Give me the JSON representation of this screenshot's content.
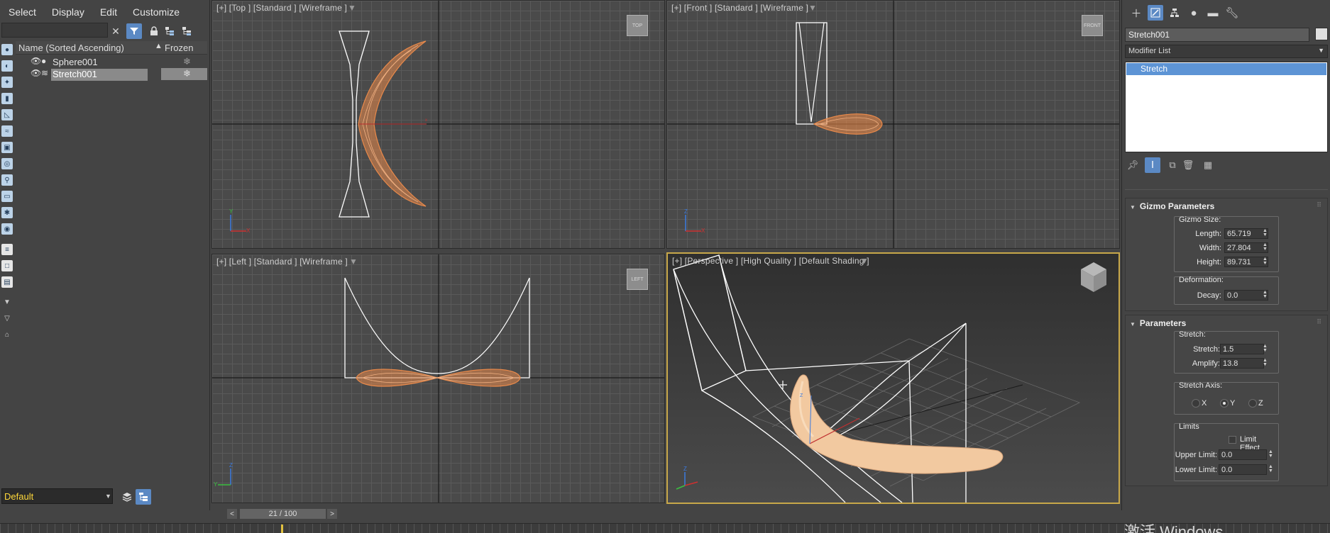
{
  "menu": {
    "items": [
      "Select",
      "Display",
      "Edit",
      "Customize"
    ]
  },
  "explorer": {
    "search_placeholder": "",
    "columns": {
      "name": "Name (Sorted Ascending)",
      "sort_glyph": "▲",
      "frozen": "Frozen"
    },
    "rows": [
      {
        "name": "Sphere001",
        "frozen_glyph": "❄"
      },
      {
        "name": "Stretch001",
        "frozen_glyph": "❄"
      }
    ],
    "selected_row": "Stretch001"
  },
  "layer": {
    "current": "Default"
  },
  "viewports": {
    "top": {
      "label": "[+] [Top ] [Standard ] [Wireframe ]",
      "cube": "TOP"
    },
    "front": {
      "label": "[+] [Front ] [Standard ] [Wireframe ]",
      "cube": "FRONT"
    },
    "left": {
      "label": "[+] [Left ] [Standard ] [Wireframe ]",
      "cube": "LEFT"
    },
    "perspective": {
      "label": "[+] [Perspective ] [High Quality ] [Default Shading ]"
    }
  },
  "timeline": {
    "frame_display": "21 / 100",
    "prev": "<",
    "next": ">"
  },
  "watermark": "激活 Windows",
  "command_panel": {
    "object_name": "Stretch001",
    "modifier_list_label": "Modifier List",
    "stack": [
      "Stretch"
    ],
    "gizmo_parameters": {
      "title": "Gizmo Parameters",
      "gizmo_size_label": "Gizmo Size:",
      "length_label": "Length:",
      "length": "65.719",
      "width_label": "Width:",
      "width": "27.804",
      "height_label": "Height:",
      "height": "89.731",
      "deformation_label": "Deformation:",
      "decay_label": "Decay:",
      "decay": "0.0"
    },
    "parameters": {
      "title": "Parameters",
      "stretch_group_label": "Stretch:",
      "stretch_label": "Stretch:",
      "stretch": "1.5",
      "amplify_label": "Amplify:",
      "amplify": "13.8",
      "stretch_axis_label": "Stretch Axis:",
      "axis_x": "X",
      "axis_y": "Y",
      "axis_z": "Z",
      "selected_axis": "Y",
      "limits_label": "Limits",
      "limit_effect_label": "Limit Effect",
      "limit_effect_checked": false,
      "upper_limit_label": "Upper Limit:",
      "upper_limit": "0.0",
      "lower_limit_label": "Lower Limit:",
      "lower_limit": "0.0"
    }
  },
  "colors": {
    "selection_blue": "#5d94d5",
    "layer_text": "#ffd83a",
    "wire_orange": "#e8894a",
    "active_viewport_border": "#c8a84a"
  }
}
